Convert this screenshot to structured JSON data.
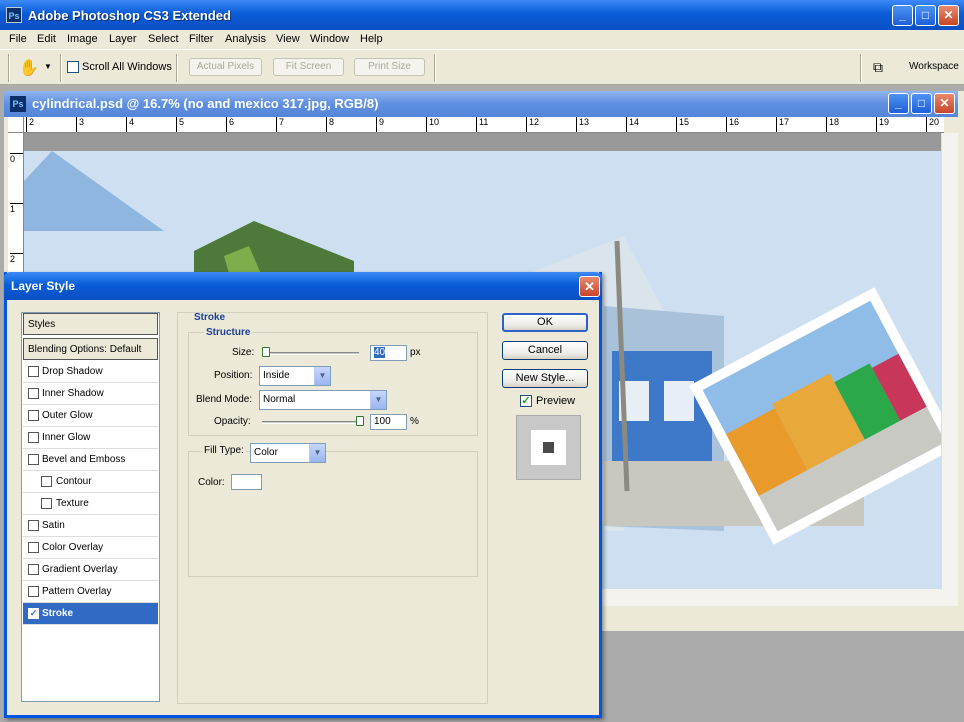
{
  "app": {
    "title": "Adobe Photoshop CS3 Extended",
    "logo": "Ps",
    "controls": {
      "minimize": "_",
      "maximize": "□",
      "close": "✕"
    }
  },
  "menu": [
    "File",
    "Edit",
    "Image",
    "Layer",
    "Select",
    "Filter",
    "Analysis",
    "View",
    "Window",
    "Help"
  ],
  "options": {
    "tool_icon": "hand-tool-icon",
    "tool_glyph": "✋",
    "scroll_all_windows": "Scroll All Windows",
    "actual_pixels": "Actual Pixels",
    "fit_screen": "Fit Screen",
    "print_size": "Print Size",
    "workspace": "Workspace"
  },
  "document": {
    "title": "cylindrical.psd @ 16.7% (no and mexico 317.jpg, RGB/8)",
    "ruler_h": [
      "2",
      "3",
      "4",
      "5",
      "6",
      "7",
      "8",
      "9",
      "10",
      "11",
      "12",
      "13",
      "14",
      "15",
      "16",
      "17",
      "18",
      "19",
      "20"
    ],
    "ruler_v": [
      "0",
      "1",
      "2"
    ]
  },
  "dialog": {
    "title": "Layer Style",
    "styles_header": "Styles",
    "blending_options": "Blending Options: Default",
    "effects": [
      {
        "label": "Drop Shadow",
        "checked": false
      },
      {
        "label": "Inner Shadow",
        "checked": false
      },
      {
        "label": "Outer Glow",
        "checked": false
      },
      {
        "label": "Inner Glow",
        "checked": false
      },
      {
        "label": "Bevel and Emboss",
        "checked": false
      },
      {
        "label": "Contour",
        "checked": false
      },
      {
        "label": "Texture",
        "checked": false
      },
      {
        "label": "Satin",
        "checked": false
      },
      {
        "label": "Color Overlay",
        "checked": false
      },
      {
        "label": "Gradient Overlay",
        "checked": false
      },
      {
        "label": "Pattern Overlay",
        "checked": false
      },
      {
        "label": "Stroke",
        "checked": true
      }
    ],
    "stroke": {
      "section": "Stroke",
      "structure": "Structure",
      "size_label": "Size:",
      "size_value": "40",
      "size_unit": "px",
      "size_level": 0.04,
      "position_label": "Position:",
      "position_value": "Inside",
      "blend_mode_label": "Blend Mode:",
      "blend_mode_value": "Normal",
      "opacity_label": "Opacity:",
      "opacity_value": "100",
      "opacity_unit": "%",
      "opacity_level": 1.0,
      "fill_type_label": "Fill Type:",
      "fill_type_value": "Color",
      "color_label": "Color:",
      "color_value": "#ffffff"
    },
    "buttons": {
      "ok": "OK",
      "cancel": "Cancel",
      "new_style": "New Style...",
      "preview": "Preview"
    },
    "preview_checked": true
  }
}
